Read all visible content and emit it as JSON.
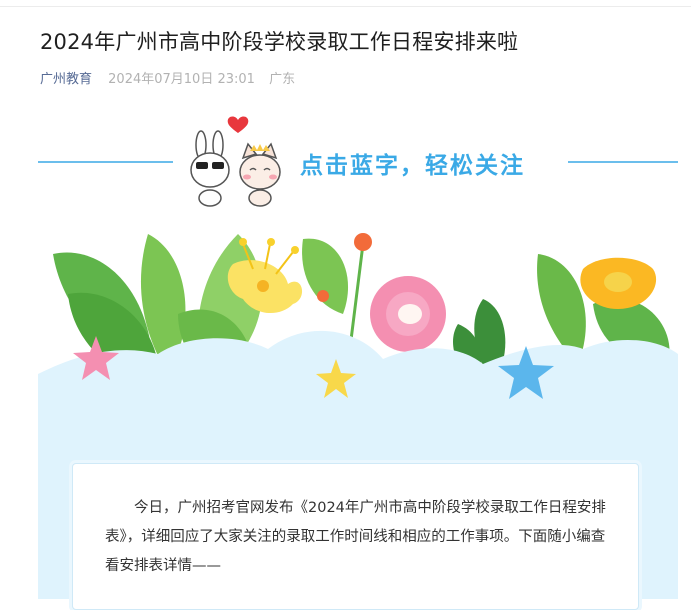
{
  "article": {
    "title": "2024年广州市高中阶段学校录取工作日程安排来啦",
    "account": "广州教育",
    "date": "2024年07月10日 23:01",
    "region": "广东"
  },
  "banner": {
    "follow_text": "点击蓝字，轻松关注"
  },
  "intro": {
    "text": "今日，广州招考官网发布《2024年广州市高中阶段学校录取工作日程安排表》，详细回应了大家关注的录取工作时间线和相应的工作事项。下面随小编查看安排表详情——"
  },
  "colors": {
    "accent_blue": "#3aa9e6",
    "account_link": "#576b95",
    "meta_gray": "#b2b2b2",
    "water_light": "#dff3fd",
    "leaf_green": "#6cc24a"
  }
}
